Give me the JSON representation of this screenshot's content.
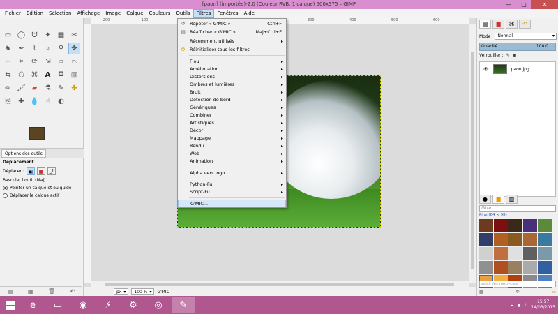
{
  "window": {
    "title": "[paon] (importée)-2.0 (Couleur RVB, 1 calque) 500x375 – GIMP",
    "min": "—",
    "max": "□",
    "close": "✕"
  },
  "menubar": [
    "Fichier",
    "Édition",
    "Sélection",
    "Affichage",
    "Image",
    "Calque",
    "Couleurs",
    "Outils",
    "Filtres",
    "Fenêtres",
    "Aide"
  ],
  "filters_menu": {
    "items": [
      {
        "label": "Répéter « G'MIC »",
        "shortcut": "Ctrl+F",
        "icon": "↺"
      },
      {
        "label": "Réafficher « G'MIC »",
        "shortcut": "Maj+Ctrl+F",
        "icon": "▤"
      },
      {
        "label": "Récemment utilisés",
        "arrow": "▸"
      },
      {
        "label": "Réinitialiser tous les filtres",
        "icon": "⚙"
      },
      {
        "label": "Flou",
        "arrow": "▸"
      },
      {
        "label": "Amélioration",
        "arrow": "▸"
      },
      {
        "label": "Distorsions",
        "arrow": "▸"
      },
      {
        "label": "Ombres et lumières",
        "arrow": "▸"
      },
      {
        "label": "Bruit",
        "arrow": "▸"
      },
      {
        "label": "Détection de bord",
        "arrow": "▸"
      },
      {
        "label": "Génériques",
        "arrow": "▸"
      },
      {
        "label": "Combiner",
        "arrow": "▸"
      },
      {
        "label": "Artistiques",
        "arrow": "▸"
      },
      {
        "label": "Décor",
        "arrow": "▸"
      },
      {
        "label": "Mappage",
        "arrow": "▸"
      },
      {
        "label": "Rendu",
        "arrow": "▸"
      },
      {
        "label": "Web",
        "arrow": "▸"
      },
      {
        "label": "Animation",
        "arrow": "▸"
      },
      {
        "label": "Alpha vers logo",
        "arrow": "▸"
      },
      {
        "label": "Python-Fu",
        "arrow": "▸"
      },
      {
        "label": "Script-Fu",
        "arrow": "▸"
      },
      {
        "label": "G'MIC..."
      }
    ]
  },
  "toolbox": {
    "tab_label": "Options des outils",
    "section": "Déplacement",
    "move_label": "Déplacer :",
    "toggle_label": "Basculer l'outil  (Maj)",
    "option1": "Pointer un calque et ou guide",
    "option2": "Déplacer le calque actif"
  },
  "canvas": {
    "ruler_marks": [
      "-200",
      "-100",
      "0",
      "100",
      "200",
      "300",
      "400",
      "500",
      "600"
    ],
    "unit": "px",
    "zoom": "100 %",
    "status": "G'MIC"
  },
  "dock": {
    "mode_label": "Mode",
    "mode_value": "Normal",
    "opacity_label": "Opacité",
    "opacity_value": "100.0",
    "lock_label": "Verrouiller :",
    "layer_name": "paon.jpg",
    "filter_placeholder": "filtre",
    "pattern_label": "Pine (64 × 98)",
    "tag_placeholder": "saisir les mots-clés"
  },
  "taskbar": {
    "time": "15:57",
    "date": "14/03/2015"
  },
  "colors": {
    "foreground": "#5a4520",
    "background": "#ffffff",
    "taskbar": "#b0578f",
    "titlebar": "#d98fcf"
  }
}
